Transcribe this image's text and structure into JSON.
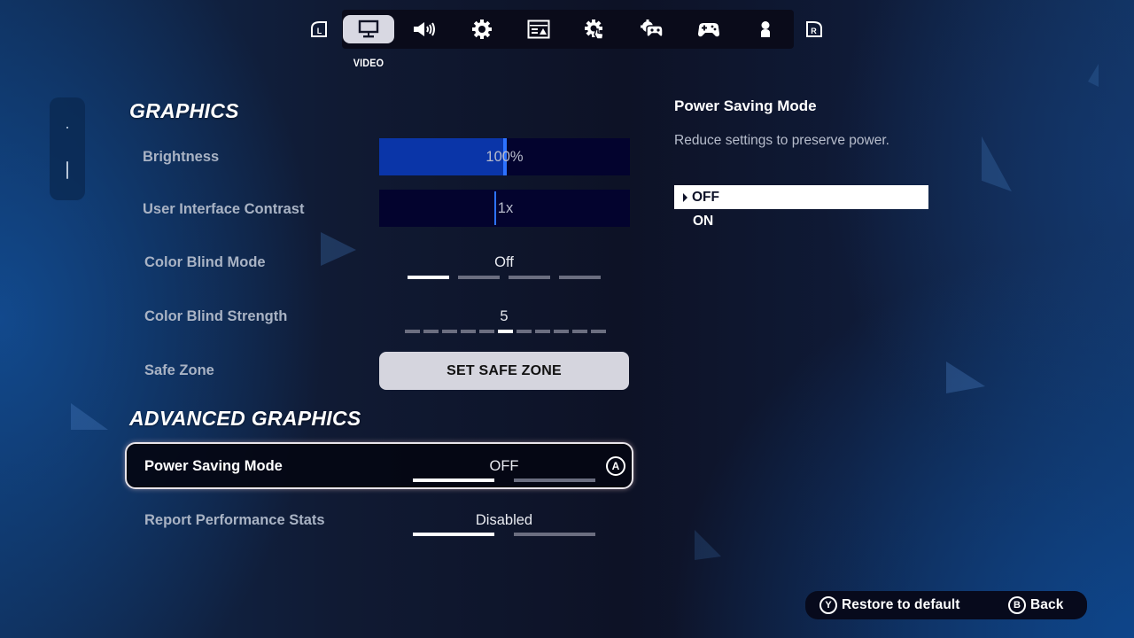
{
  "top_nav": {
    "left_bumper": "L",
    "right_bumper": "R",
    "active_tab_label": "VIDEO",
    "tabs": [
      {
        "id": "video",
        "icon": "monitor-icon",
        "active": true
      },
      {
        "id": "audio",
        "icon": "speaker-icon",
        "active": false
      },
      {
        "id": "game",
        "icon": "gear-icon",
        "active": false
      },
      {
        "id": "accessibility",
        "icon": "ui-layout-icon",
        "active": false
      },
      {
        "id": "touch",
        "icon": "touch-gear-icon",
        "active": false
      },
      {
        "id": "controller-settings",
        "icon": "controller-gear-icon",
        "active": false
      },
      {
        "id": "controller",
        "icon": "gamepad-icon",
        "active": false
      },
      {
        "id": "account",
        "icon": "person-icon",
        "active": false
      }
    ]
  },
  "sections": {
    "graphics": {
      "title": "GRAPHICS",
      "brightness": {
        "label": "Brightness",
        "value": "100%",
        "fraction": 0.5
      },
      "ui_contrast": {
        "label": "User Interface Contrast",
        "value": "1x",
        "fraction": 0.46
      },
      "color_blind_mode": {
        "label": "Color Blind Mode",
        "value": "Off",
        "options_count": 4,
        "selected_index": 0
      },
      "color_blind_strength": {
        "label": "Color Blind Strength",
        "value": "5",
        "steps": 11,
        "selected_index": 5
      },
      "safe_zone": {
        "label": "Safe Zone",
        "button": "SET SAFE ZONE"
      }
    },
    "advanced_graphics": {
      "title": "ADVANCED GRAPHICS",
      "power_saving": {
        "label": "Power Saving Mode",
        "value": "OFF",
        "options_count": 2,
        "selected_index": 0,
        "confirm_button": "A"
      },
      "perf_stats": {
        "label": "Report Performance Stats",
        "value": "Disabled",
        "options_count": 2,
        "selected_index": 0
      }
    }
  },
  "detail_panel": {
    "title": "Power Saving Mode",
    "description": "Reduce settings to preserve power.",
    "options": [
      {
        "label": "OFF",
        "selected": true
      },
      {
        "label": "ON",
        "selected": false
      }
    ]
  },
  "footer": {
    "restore": {
      "button": "Y",
      "label": "Restore to default"
    },
    "back": {
      "button": "B",
      "label": "Back"
    }
  },
  "colors": {
    "slider_fill": "#0a35a8",
    "slider_track": "#03032e",
    "slider_knob": "#2d72ff",
    "segment_on": "#ffffff",
    "segment_off": "#6b6e80"
  }
}
